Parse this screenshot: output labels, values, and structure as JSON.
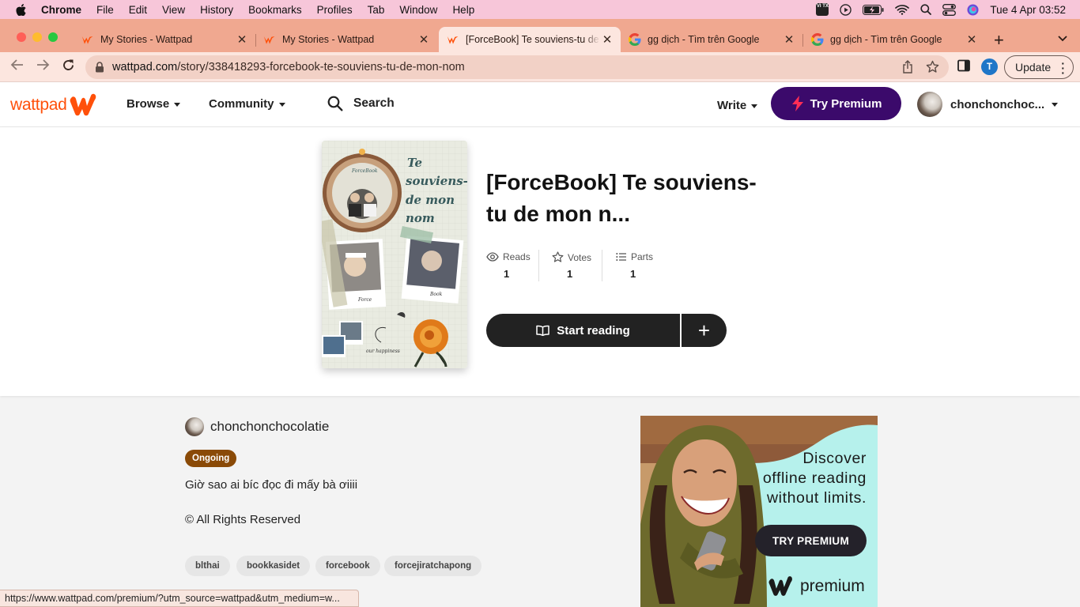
{
  "menubar": {
    "app": "Chrome",
    "items": [
      "File",
      "Edit",
      "View",
      "History",
      "Bookmarks",
      "Profiles",
      "Tab",
      "Window",
      "Help"
    ],
    "input_badge": "VI TX",
    "clock": "Tue 4 Apr  03:52"
  },
  "tabs": [
    {
      "title": "My Stories - Wattpad",
      "favicon": "wattpad-icon"
    },
    {
      "title": "My Stories - Wattpad",
      "favicon": "wattpad-icon"
    },
    {
      "title": "[ForceBook] Te souviens-tu de mon nom",
      "favicon": "wattpad-icon",
      "active": true
    },
    {
      "title": "gg dịch - Tìm trên Google",
      "favicon": "google-icon"
    },
    {
      "title": "gg dịch - Tìm trên Google",
      "favicon": "google-icon"
    }
  ],
  "toolbar": {
    "url_host": "wattpad.com",
    "url_path": "/story/338418293-forcebook-te-souviens-tu-de-mon-nom",
    "profile_initial": "T",
    "update_label": "Update"
  },
  "header": {
    "logo_text": "wattpad",
    "browse": "Browse",
    "community": "Community",
    "search": "Search",
    "write": "Write",
    "premium": "Try Premium",
    "username": "chonchonchoc..."
  },
  "story": {
    "title": "[ForceBook] Te souviens-tu de mon n...",
    "cover": {
      "title_lines": [
        "Te",
        "souviens-tu",
        "de mon",
        "nom"
      ],
      "medallion_label": "ForceBook",
      "photo1_label": "Force",
      "photo2_label": "Book",
      "footer_label": "our happiness"
    },
    "stats": [
      {
        "label": "Reads",
        "value": "1",
        "icon": "eye-icon"
      },
      {
        "label": "Votes",
        "value": "1",
        "icon": "star-icon"
      },
      {
        "label": "Parts",
        "value": "1",
        "icon": "list-icon"
      }
    ],
    "start_reading": "Start reading",
    "add": "+",
    "author": "chonchonchocolatie",
    "status": "Ongoing",
    "description": "Giờ sao ai bíc đọc đi mấy bà ơiiii",
    "copyright": "© All Rights Reserved",
    "tags": [
      "blthai",
      "bookkasidet",
      "forcebook",
      "forcejiratchapong"
    ]
  },
  "ad": {
    "lines": [
      "Discover",
      "offline reading",
      "without limits."
    ],
    "button": "TRY PREMIUM",
    "brand": "premium"
  },
  "statusbar": {
    "url": "https://www.wattpad.com/premium/?utm_source=wattpad&utm_medium=w..."
  },
  "colors": {
    "menubar": "#f7c6d9",
    "tabstrip": "#f0a890",
    "wattpad_orange": "#ff500a",
    "premium_purple": "#3b0a6b",
    "ongoing_badge": "#8a4a07",
    "ad_bg": "#b6f1ec"
  }
}
